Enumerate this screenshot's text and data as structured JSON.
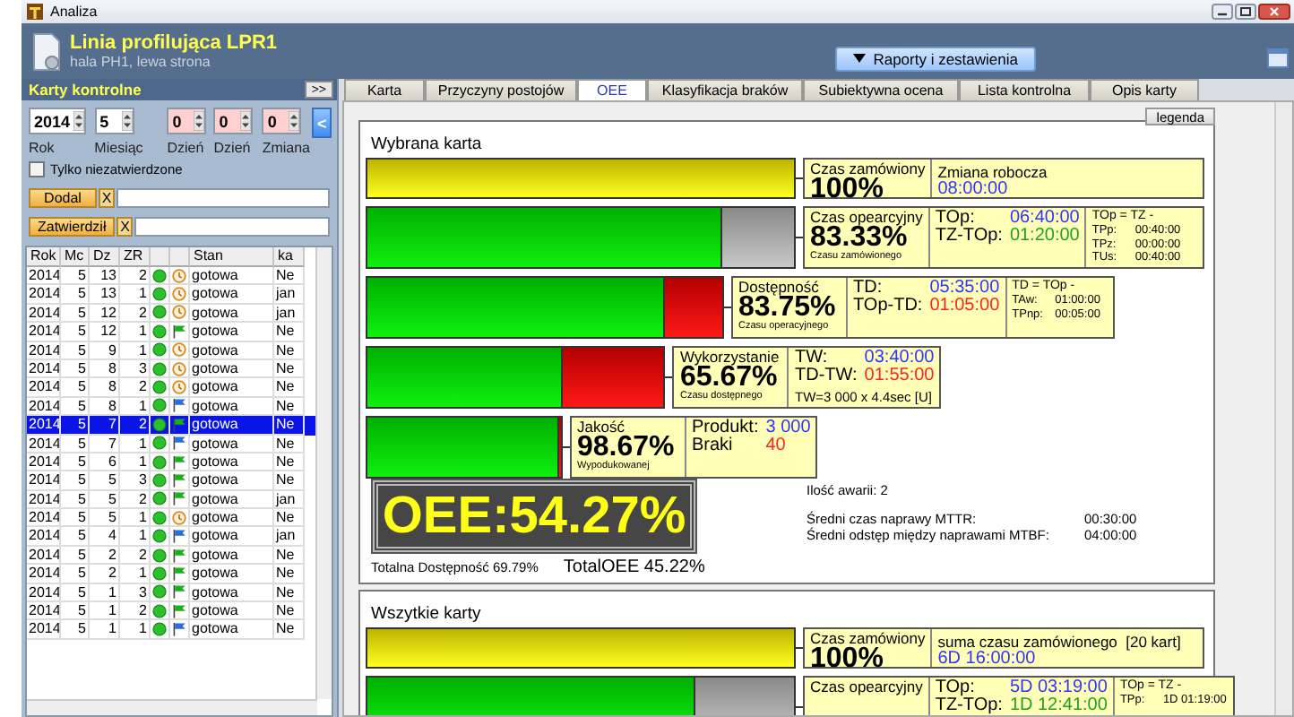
{
  "window": {
    "title": "Analiza"
  },
  "header": {
    "title": "Linia profilująca LPR1",
    "subtitle": "hala PH1, lewa strona",
    "reports_button": "Raporty i zestawienia"
  },
  "left_panel": {
    "title": "Karty kontrolne",
    "collapse_button": ">>",
    "filters": [
      {
        "label": "Rok",
        "value": "2014",
        "kind": "set"
      },
      {
        "label": "Miesiąc",
        "value": "5",
        "kind": "set"
      },
      {
        "label": "Dzień",
        "value": "0",
        "kind": "unset"
      },
      {
        "label": "Dzień",
        "value": "0",
        "kind": "unset"
      },
      {
        "label": "Zmiana",
        "value": "0",
        "kind": "unset"
      }
    ],
    "back_button": "<",
    "checkbox": {
      "label": "Tylko niezatwierdzone",
      "checked": false
    },
    "user_filters": [
      {
        "label": "Dodal",
        "clear": "X"
      },
      {
        "label": "Zatwierdził",
        "clear": "X"
      }
    ],
    "table": {
      "columns": [
        "Rok",
        "Mc",
        "Dz",
        "ZR",
        "Stan",
        "ka"
      ],
      "rows": [
        {
          "rok": "2014",
          "mc": "5",
          "dz": "13",
          "zr": "2",
          "kind": "clock",
          "stan": "gotowa",
          "ka": "Ne",
          "selected": false
        },
        {
          "rok": "2014",
          "mc": "5",
          "dz": "13",
          "zr": "1",
          "kind": "clock",
          "stan": "gotowa",
          "ka": "jan",
          "selected": false
        },
        {
          "rok": "2014",
          "mc": "5",
          "dz": "12",
          "zr": "2",
          "kind": "clock",
          "stan": "gotowa",
          "ka": "jan",
          "selected": false
        },
        {
          "rok": "2014",
          "mc": "5",
          "dz": "12",
          "zr": "1",
          "kind": "green",
          "stan": "gotowa",
          "ka": "Ne",
          "selected": false
        },
        {
          "rok": "2014",
          "mc": "5",
          "dz": "9",
          "zr": "1",
          "kind": "clock",
          "stan": "gotowa",
          "ka": "Ne",
          "selected": false
        },
        {
          "rok": "2014",
          "mc": "5",
          "dz": "8",
          "zr": "3",
          "kind": "clock",
          "stan": "gotowa",
          "ka": "Ne",
          "selected": false
        },
        {
          "rok": "2014",
          "mc": "5",
          "dz": "8",
          "zr": "2",
          "kind": "clock",
          "stan": "gotowa",
          "ka": "Ne",
          "selected": false
        },
        {
          "rok": "2014",
          "mc": "5",
          "dz": "8",
          "zr": "1",
          "kind": "blue",
          "stan": "gotowa",
          "ka": "Ne",
          "selected": false
        },
        {
          "rok": "2014",
          "mc": "5",
          "dz": "7",
          "zr": "2",
          "kind": "green",
          "stan": "gotowa",
          "ka": "Ne",
          "selected": true
        },
        {
          "rok": "2014",
          "mc": "5",
          "dz": "7",
          "zr": "1",
          "kind": "blue",
          "stan": "gotowa",
          "ka": "Ne",
          "selected": false
        },
        {
          "rok": "2014",
          "mc": "5",
          "dz": "6",
          "zr": "1",
          "kind": "green",
          "stan": "gotowa",
          "ka": "Ne",
          "selected": false
        },
        {
          "rok": "2014",
          "mc": "5",
          "dz": "5",
          "zr": "3",
          "kind": "green",
          "stan": "gotowa",
          "ka": "Ne",
          "selected": false
        },
        {
          "rok": "2014",
          "mc": "5",
          "dz": "5",
          "zr": "2",
          "kind": "green",
          "stan": "gotowa",
          "ka": "jan",
          "selected": false
        },
        {
          "rok": "2014",
          "mc": "5",
          "dz": "5",
          "zr": "1",
          "kind": "clock",
          "stan": "gotowa",
          "ka": "Ne",
          "selected": false
        },
        {
          "rok": "2014",
          "mc": "5",
          "dz": "4",
          "zr": "1",
          "kind": "blue",
          "stan": "gotowa",
          "ka": "jan",
          "selected": false
        },
        {
          "rok": "2014",
          "mc": "5",
          "dz": "2",
          "zr": "2",
          "kind": "green",
          "stan": "gotowa",
          "ka": "Ne",
          "selected": false
        },
        {
          "rok": "2014",
          "mc": "5",
          "dz": "2",
          "zr": "1",
          "kind": "green",
          "stan": "gotowa",
          "ka": "Ne",
          "selected": false
        },
        {
          "rok": "2014",
          "mc": "5",
          "dz": "1",
          "zr": "3",
          "kind": "green",
          "stan": "gotowa",
          "ka": "Ne",
          "selected": false
        },
        {
          "rok": "2014",
          "mc": "5",
          "dz": "1",
          "zr": "2",
          "kind": "green",
          "stan": "gotowa",
          "ka": "Ne",
          "selected": false
        },
        {
          "rok": "2014",
          "mc": "5",
          "dz": "1",
          "zr": "1",
          "kind": "blue",
          "stan": "gotowa",
          "ka": "Ne",
          "selected": false
        }
      ]
    }
  },
  "tabs": [
    {
      "label": "Karta",
      "selected": false
    },
    {
      "label": "Przyczyny postojów",
      "selected": false
    },
    {
      "label": "OEE",
      "selected": true
    },
    {
      "label": "Klasyfikacja braków",
      "selected": false
    },
    {
      "label": "Subiektywna ocena",
      "selected": false
    },
    {
      "label": "Lista kontrolna",
      "selected": false
    },
    {
      "label": "Opis karty",
      "selected": false
    }
  ],
  "legend_button": "legenda",
  "groups": [
    {
      "title": "Wybrana karta",
      "rows": [
        {
          "kind": "ordered",
          "level": 1,
          "title": "Czas zamówiony",
          "percent": "100%",
          "details": [
            {
              "label": "Zmiana robocza",
              "value": "08:00:00",
              "color": "#3333ff"
            }
          ]
        },
        {
          "kind": "operating",
          "level": 0.8333,
          "title": "Czas opearcyjny",
          "percent": "83.33%",
          "caption": "Czasu zamówionego",
          "details": [
            {
              "label": "TOp:",
              "value": "06:40:00",
              "color": "#3333ff"
            },
            {
              "label": "TZ-TOp:",
              "value": "01:20:00",
              "color": "#22a022"
            }
          ],
          "notes": {
            "title": "TOp = TZ -",
            "lines": [
              {
                "label": "TPp:",
                "value": "00:40:00"
              },
              {
                "label": "TPz:",
                "value": "00:00:00"
              },
              {
                "label": "TUs:",
                "value": "00:40:00"
              }
            ]
          }
        },
        {
          "kind": "loss",
          "level": 0.8375,
          "title": "Dostępność",
          "percent": "83.75%",
          "caption": "Czasu operacyjnego",
          "details": [
            {
              "label": "TD:",
              "value": "05:35:00",
              "color": "#3333ff"
            },
            {
              "label": "TOp-TD:",
              "value": "01:05:00",
              "color": "#ff2222"
            }
          ],
          "notes": {
            "title": "TD = TOp -",
            "lines": [
              {
                "label": "TAw:",
                "value": "01:00:00"
              },
              {
                "label": "TPnp:",
                "value": "00:05:00"
              }
            ]
          }
        },
        {
          "kind": "loss",
          "level": 0.6567,
          "title": "Wykorzystanie",
          "percent": "65.67%",
          "caption": "Czasu dostępnego",
          "details": [
            {
              "label": "TW:",
              "value": "03:40:00",
              "color": "#3333ff"
            },
            {
              "label": "TD-TW:",
              "value": "01:55:00",
              "color": "#ff2222"
            }
          ],
          "footnote": "TW=3 000 x 4.4sec [U]"
        },
        {
          "kind": "loss",
          "level": 0.9867,
          "title": "Jakość",
          "percent": "98.67%",
          "caption": "Wypodukowanej",
          "details": [
            {
              "label": "Produkt:",
              "value": "3 000",
              "color": "#3333ff"
            },
            {
              "label": "Braki",
              "value": "40",
              "color": "#ff2222"
            }
          ]
        }
      ],
      "summary": {
        "oee": "OEE:54.27%",
        "failures": "Ilość awarii: 2",
        "stats": [
          {
            "label": "Średni czas naprawy MTTR:",
            "value": "00:30:00"
          },
          {
            "label": "Średni odstęp między naprawami MTBF:",
            "value": "04:00:00"
          }
        ],
        "totals": [
          "Totalna Dostępność 69.79%",
          "TotalOEE 45.22%"
        ]
      }
    },
    {
      "title": "Wszytkie karty",
      "rows": [
        {
          "kind": "ordered",
          "level": 1,
          "title": "Czas zamówiony",
          "percent": "100%",
          "details": [
            {
              "label": "suma czasu zamówionego  [20 kart]",
              "value": "6D 16:00:00",
              "color": "#3333ff"
            }
          ]
        },
        {
          "kind": "operating",
          "level": 0.7707,
          "title": "Czas opearcyjny",
          "details": [
            {
              "label": "TOp:",
              "value": "5D 03:19:00",
              "color": "#3333ff"
            },
            {
              "label": "TZ-TOp:",
              "value": "1D 12:41:00",
              "color": "#22a022"
            }
          ],
          "notes": {
            "title": "TOp = TZ -",
            "lines": [
              {
                "label": "TPp:",
                "value": "1D 01:19:00"
              }
            ]
          }
        }
      ]
    }
  ]
}
